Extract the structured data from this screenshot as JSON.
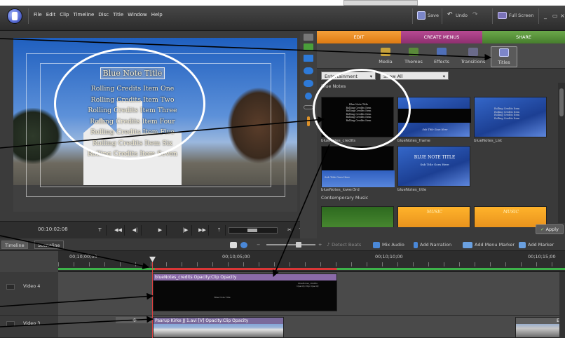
{
  "menubar": {
    "items": [
      "File",
      "Edit",
      "Clip",
      "Timeline",
      "Disc",
      "Title",
      "Window",
      "Help"
    ]
  },
  "toolbar": {
    "save_label": "Save",
    "undo_label": "Undo",
    "fullscreen_label": "Full Screen"
  },
  "monitor": {
    "title_text": "Blue Note Title",
    "credits": [
      "Rolling Credits Item One",
      "Rolling Credits Item Two",
      "Rolling Credits Item Three",
      "Rolling Credits Item Four",
      "Rolling Credits Item Five",
      "Rolling Credits Item Six",
      "Rolling Credits Item Seven"
    ],
    "timecode": "00:10:02:08"
  },
  "panel": {
    "tabs": {
      "edit": "EDIT",
      "create_menus": "CREATE MENUS",
      "share": "SHARE"
    },
    "subtabs": {
      "media": "Media",
      "themes": "Themes",
      "effects": "Effects",
      "transitions": "Transitions",
      "titles": "Titles"
    },
    "category_dropdown": "Entertainment",
    "show_dropdown": "Show All",
    "group_blue_notes": "Blue Notes",
    "group_contemporary": "Contemporary Music",
    "thumbs": [
      {
        "label": "blueNotes_credits"
      },
      {
        "label": "blueNotes_frame"
      },
      {
        "label": "blueNotes_List"
      },
      {
        "label": "blueNotes_lower3rd"
      },
      {
        "label": "blueNotes_title"
      }
    ],
    "thumb_text": {
      "blue_note_title": "Blue Note Title",
      "title_caps": "BLUE NOTE TITLE",
      "sub_line": "Sub Title Goes Here",
      "credit_line": "Rolling Credits Item",
      "music_word": "MUSIC"
    },
    "apply_label": "Apply"
  },
  "timeline": {
    "tab_timeline": "Timeline",
    "tab_sceneline": "Sceneline",
    "detect_beats": "Detect Beats",
    "mix_audio": "Mix Audio",
    "add_narration": "Add Narration",
    "add_menu_marker": "Add Menu Marker",
    "add_marker": "Add Marker",
    "ruler_labels": [
      "00;10;00;00",
      "00;10;05;00",
      "00;10;10;00",
      "00;10;15;00"
    ],
    "tracks": [
      {
        "name": "Video 4"
      },
      {
        "name": "Video 3"
      }
    ],
    "clip_title": "blueNotes_credits  Opacity:Clip Opacity",
    "clip_video": "Paarup Kirke JJ 1.avi [V]  Opacity:Clip Opacity",
    "clip_right_label": "Eri"
  },
  "colors": {
    "edit_tab": "#de7a12",
    "menus_tab": "#8e2f6f",
    "share_tab": "#467d2d",
    "playhead": "#e04040",
    "annotation": "#000000",
    "highlight_ellipse": "#ffffff"
  },
  "icons": {
    "logo": "premiere-elements-logo",
    "save": "save-icon",
    "undo": "undo-icon",
    "redo": "redo-icon",
    "fullscreen": "fullscreen-icon"
  }
}
